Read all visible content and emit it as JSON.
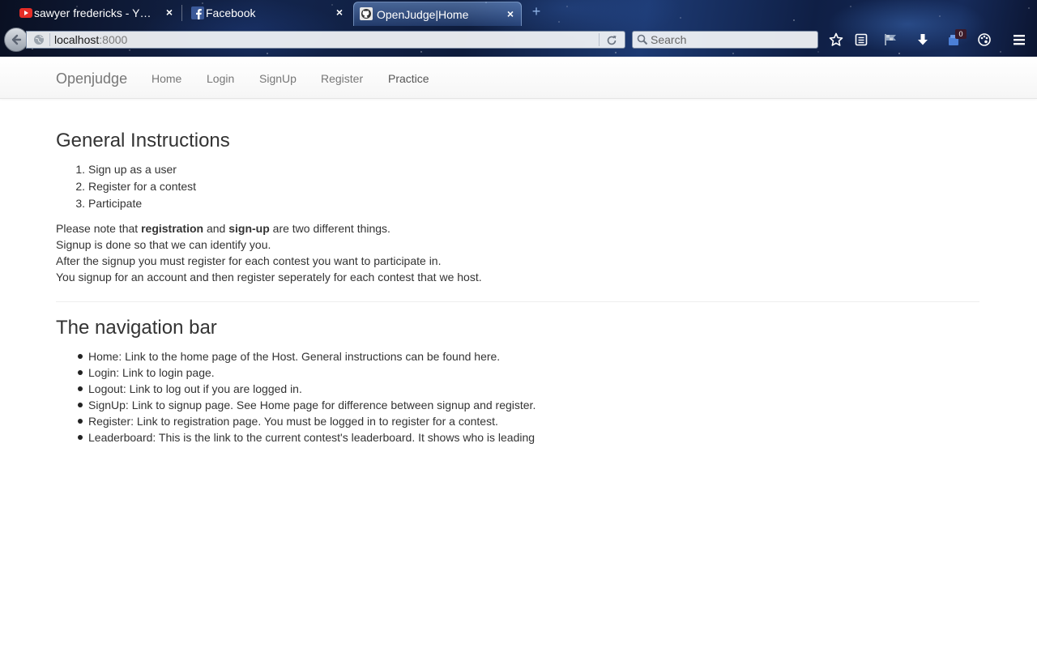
{
  "browser": {
    "tabs": [
      {
        "title": "sawyer fredericks - Y…",
        "icon": "youtube-icon"
      },
      {
        "title": "Facebook",
        "icon": "facebook-icon"
      },
      {
        "title": "OpenJudge|Home",
        "icon": "github-icon",
        "active": true
      }
    ],
    "url_host": "localhost",
    "url_port": ":8000",
    "search_placeholder": "Search",
    "notification_count": "0",
    "accent": "#1d3a73"
  },
  "navbar": {
    "brand": "Openjudge",
    "links": [
      "Home",
      "Login",
      "SignUp",
      "Register",
      "Practice"
    ]
  },
  "instructions": {
    "heading": "General Instructions",
    "steps": [
      "Sign up as a user",
      "Register for a contest",
      "Participate"
    ],
    "note_prefix": "Please note that ",
    "note_bold1": "registration",
    "note_mid": " and ",
    "note_bold2": "sign-up",
    "note_suffix": " are two different things.",
    "lines": [
      "Signup is done so that we can identify you.",
      "After the signup you must register for each contest you want to participate in.",
      "You signup for an account and then register seperately for each contest that we host."
    ]
  },
  "navigation_help": {
    "heading": "The navigation bar",
    "items": [
      "Home: Link to the home page of the Host. General instructions can be found here.",
      "Login: Link to login page.",
      "Logout: Link to log out if you are logged in.",
      "SignUp: Link to signup page. See Home page for difference between signup and register.",
      "Register: Link to registration page. You must be logged in to register for a contest.",
      "Leaderboard: This is the link to the current contest's leaderboard. It shows who is leading"
    ]
  }
}
